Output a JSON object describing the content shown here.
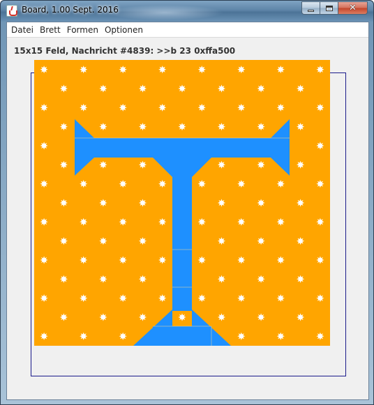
{
  "window": {
    "title": "Board, 1.00 Sept. 2016",
    "controls": {
      "minimize": "minimize",
      "maximize": "maximize",
      "close": "close"
    }
  },
  "menu": {
    "items": [
      "Datei",
      "Brett",
      "Formen",
      "Optionen"
    ]
  },
  "status_text": "15x15 Feld, Nachricht #4839: >>b 23 0xffa500",
  "board": {
    "rows": 15,
    "cols": 15,
    "background_color": "#ffa500",
    "shape_color": "#1e90ff",
    "star_color": "#ffffff",
    "icons": [
      "star-icon",
      "t-shape"
    ]
  }
}
